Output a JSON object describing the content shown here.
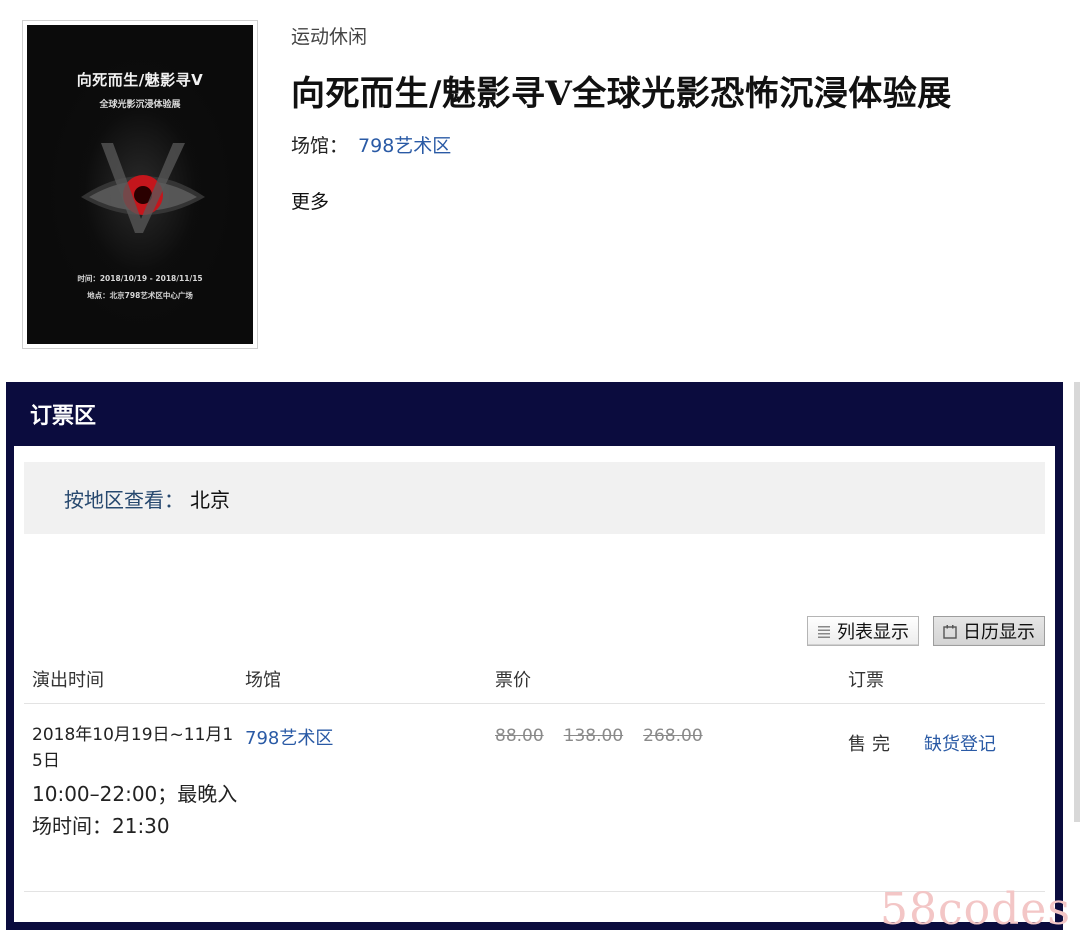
{
  "poster": {
    "title": "向死而生/魅影寻V",
    "subtitle": "全球光影沉浸体验展",
    "time_line": "时间：2018/10/19 - 2018/11/15",
    "place_line": "地点：北京798艺术区中心广场",
    "colors": {
      "background": "#0b0b0b",
      "iris": "#c4161c"
    }
  },
  "header": {
    "category": "运动休闲",
    "title": "向死而生/魅影寻V全球光影恐怖沉浸体验展",
    "venue_label": "场馆：",
    "venue_link": "798艺术区",
    "more_label": "更多"
  },
  "booking": {
    "title": "订票区",
    "region_label": "按地区查看：",
    "region_value": "北京",
    "view_list_label": "列表显示",
    "view_calendar_label": "日历显示",
    "columns": {
      "time": "演出时间",
      "venue": "场馆",
      "price": "票价",
      "order": "订票"
    },
    "rows": [
      {
        "date": "2018年10月19日~11月15日",
        "hours": "10:00–22:00；最晚入场时间：21:30",
        "venue": "798艺术区",
        "prices": [
          "88.00",
          "138.00",
          "268.00"
        ],
        "status": "售完",
        "register": "缺货登记"
      }
    ],
    "colors": {
      "panel": "#0b0c3e",
      "link": "#2a5aa5",
      "region_label": "#27496f"
    }
  },
  "watermark": "58codes"
}
